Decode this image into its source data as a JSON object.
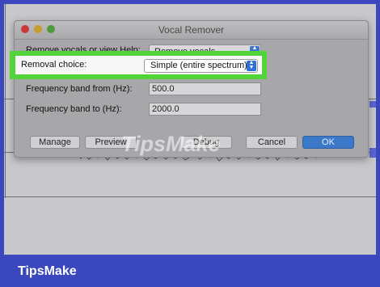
{
  "window": {
    "title": "Vocal Remover"
  },
  "dialog": {
    "remove_row": {
      "label": "Remove vocals or view Help:",
      "value": "Remove vocals"
    },
    "removal_row": {
      "label": "Removal choice:",
      "value": "Simple (entire spectrum)"
    },
    "freq_from": {
      "label": "Frequency band from (Hz):",
      "value": "500.0"
    },
    "freq_to": {
      "label": "Frequency band to (Hz):",
      "value": "2000.0"
    },
    "buttons": {
      "manage": "Manage",
      "preview": "Preview",
      "debug": "Debug",
      "cancel": "Cancel",
      "ok": "OK"
    }
  },
  "watermark": "TipsMake",
  "brand": "TipsMake",
  "colors": {
    "frame": "#3b47bd",
    "highlight": "#52d33a",
    "ok_button": "#3c78c8"
  }
}
